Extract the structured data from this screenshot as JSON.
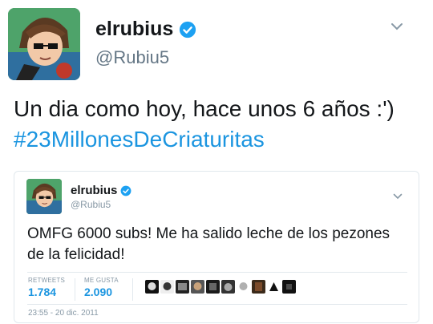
{
  "tweet": {
    "display_name": "elrubius",
    "handle": "@Rubiu5",
    "text": "Un dia como hoy, hace unos 6 años :')",
    "hashtag": "#23MillonesDeCriaturitas"
  },
  "quoted": {
    "display_name": "elrubius",
    "handle": "@Rubiu5",
    "text": "OMFG 6000 subs! Me ha salido leche de los pezones de la felicidad!",
    "retweets_label": "RETWEETS",
    "retweets_value": "1.784",
    "likes_label": "ME GUSTA",
    "likes_value": "2.090",
    "timestamp": "23:55 - 20 dic. 2011"
  },
  "colors": {
    "link": "#1b95e0",
    "verified": "#1da1f2",
    "secondary_text": "#657786"
  },
  "icons": {
    "verified": "verified-badge-icon",
    "menu": "chevron-down-icon"
  }
}
